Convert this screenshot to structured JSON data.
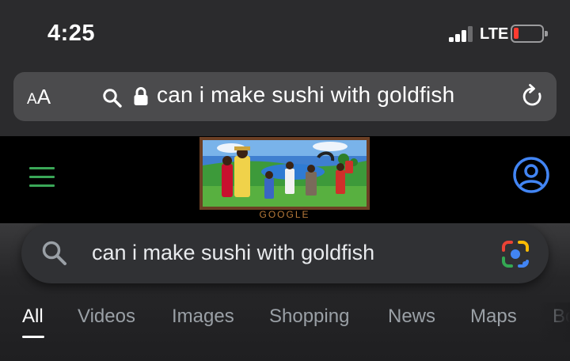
{
  "status": {
    "time": "4:25",
    "network": "LTE",
    "battery_color": "#ff3b30"
  },
  "browser": {
    "text_size_button": {
      "small": "A",
      "large": "A"
    },
    "url": "can i make sushi with goldfish",
    "search_icon": "search-icon",
    "lock_icon": "lock-icon",
    "reload_icon": "reload-icon"
  },
  "google": {
    "doodle_caption": "GOOGLE",
    "menu_icon": "hamburger-menu-icon",
    "account_icon": "account-icon",
    "search_query": "can i make sushi with goldfish",
    "lens_icon": "google-lens-icon"
  },
  "tabs": [
    {
      "label": "All",
      "active": true
    },
    {
      "label": "Videos",
      "active": false
    },
    {
      "label": "Images",
      "active": false
    },
    {
      "label": "Shopping",
      "active": false
    },
    {
      "label": "News",
      "active": false
    },
    {
      "label": "Maps",
      "active": false
    },
    {
      "label": "Bo",
      "active": false
    }
  ],
  "colors": {
    "menu_green": "#3aa757",
    "account_blue": "#4285f4"
  }
}
